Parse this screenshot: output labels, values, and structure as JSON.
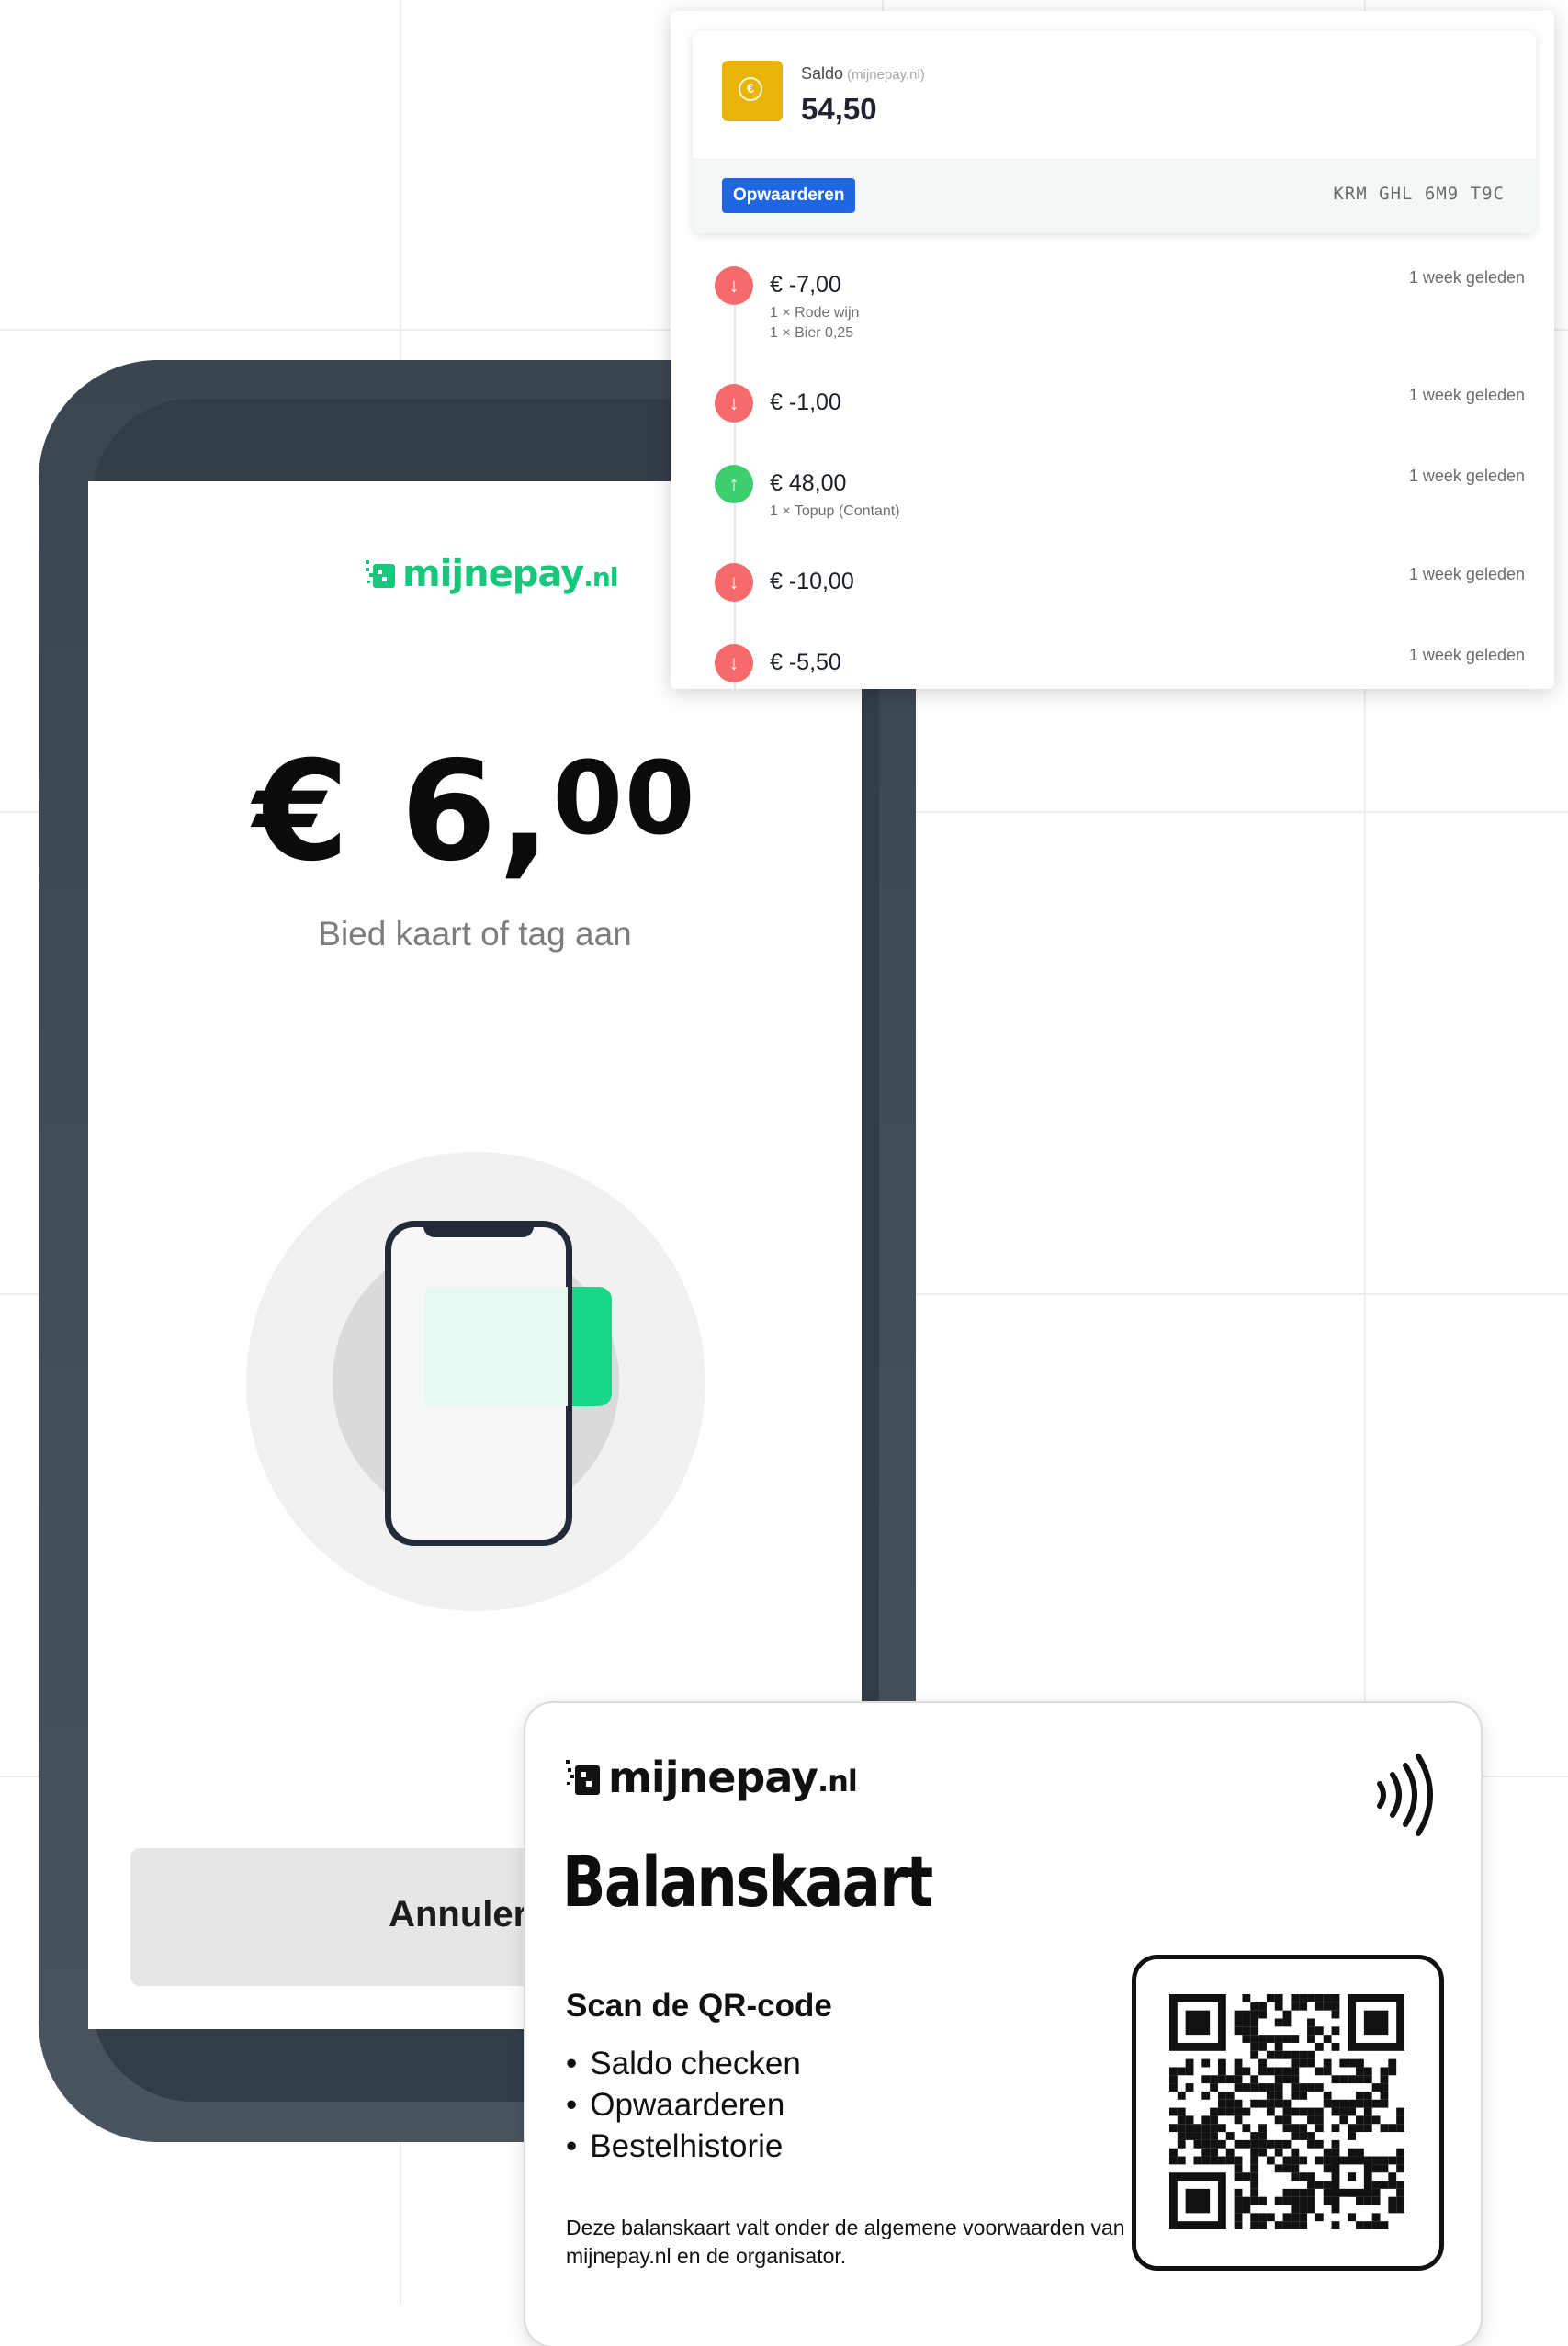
{
  "brand": {
    "name": "mijnepay",
    "tld": ".nl",
    "green": "#18c67c",
    "dark": "#111111"
  },
  "terminal": {
    "amount_main": "€ 6,",
    "amount_cents": "00",
    "prompt": "Bied kaart of tag aan",
    "cancel_label": "Annuleren"
  },
  "balance": {
    "label": "Saldo",
    "source": "(mijnepay.nl)",
    "value": "54,50",
    "topup_label": "Opwaarderen",
    "card_code": "KRM GHL 6M9 T9C",
    "coin_icon": "euro-coin-icon",
    "accent": "#eab308",
    "button_color": "#1f66e5"
  },
  "transactions": [
    {
      "direction": "down",
      "amount": "€ -7,00",
      "items": [
        "1 × Rode wijn",
        "1 × Bier 0,25"
      ],
      "time": "1 week geleden"
    },
    {
      "direction": "down",
      "amount": "€ -1,00",
      "items": [],
      "time": "1 week geleden"
    },
    {
      "direction": "up",
      "amount": "€ 48,00",
      "items": [
        "1 × Topup (Contant)"
      ],
      "time": "1 week geleden"
    },
    {
      "direction": "down",
      "amount": "€ -10,00",
      "items": [],
      "time": "1 week geleden"
    },
    {
      "direction": "down",
      "amount": "€ -5,50",
      "items": [],
      "time": "1 week geleden"
    }
  ],
  "card": {
    "title": "Balanskaart",
    "scan_heading": "Scan de QR-code",
    "features": [
      "Saldo checken",
      "Opwaarderen",
      "Bestelhistorie"
    ],
    "terms": "Deze balanskaart valt onder de algemene voorwaarden van mijnepay.nl en de organisator.",
    "nfc_icon": "contactless-icon",
    "qr_icon": "qr-code-icon"
  }
}
